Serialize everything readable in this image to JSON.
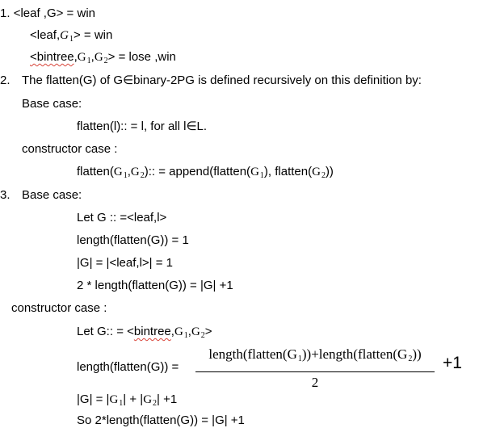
{
  "section1": {
    "label": "1. ",
    "lines": [
      {
        "pre": "<leaf ,G> = win"
      },
      {
        "pre": "<leaf,",
        "g1": "G",
        "g1_sub": "1",
        "post": "> = win"
      },
      {
        "pre_squiggle": "<bintree",
        "mid": ",",
        "g1": "G",
        "g1_sub": "1",
        "comma": ",",
        "g2": "G",
        "g2_sub": "2",
        "post": "> = lose ,win"
      }
    ]
  },
  "section2": {
    "label": "2.",
    "text": "The flatten(G) of G∈binary-2PG is defined recursively on this definition by:",
    "base_label": "Base case:",
    "base_text": "flatten(l):: = l, for all l∈L.",
    "constructor_label": "constructor case :",
    "constructor_pre": "flatten(",
    "g1": "G",
    "g1_sub": "1",
    "comma": ",",
    "g2": "G",
    "g2_sub": "2",
    "constructor_mid": "):: = append(flatten(",
    "constructor_mid2": "), flatten(",
    "constructor_post": "))"
  },
  "section3": {
    "label": "3.",
    "base_label": "Base case:",
    "base_lines": [
      "Let G :: =<leaf,l>",
      "length(flatten(G)) = 1",
      "|G| = |<leaf,l>| = 1",
      "2 * length(flatten(G)) = |G| +1"
    ],
    "constructor_label": "constructor case :",
    "let_pre": "Let G:: = <",
    "let_squiggle": "bintree",
    "let_comma": ",",
    "g1": "G",
    "g1_sub": "1",
    "g2": "G",
    "g2_sub": "2",
    "let_post": ">",
    "length_lhs": "length(flatten(G)) =",
    "frac_num_a": "length(flatten(",
    "frac_num_b": "))+length(flatten(",
    "frac_num_c": "))",
    "frac_den": "2",
    "plus_one": "+1",
    "size_pre": "|G| = |",
    "size_mid": "| + |",
    "size_post": "| +1",
    "conclusion": "So 2*length(flatten(G)) = |G| +1"
  }
}
